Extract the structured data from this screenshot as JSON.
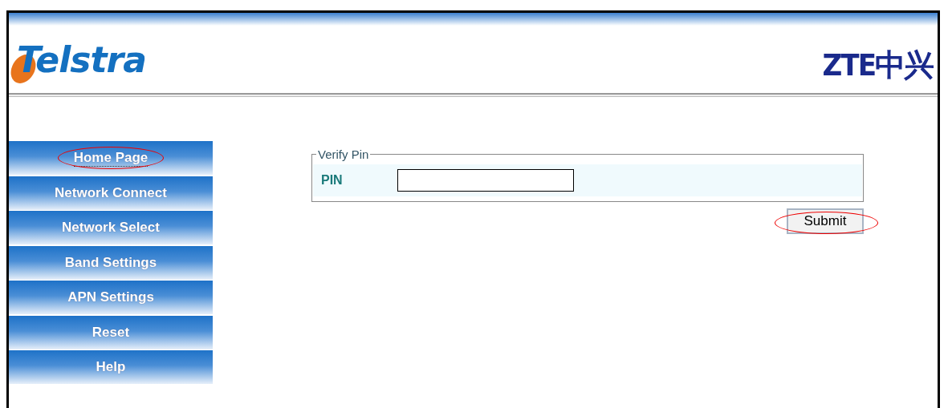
{
  "header": {
    "brand_logo": "Telstra",
    "vendor_logo": "ZTE中兴"
  },
  "sidebar": {
    "items": [
      {
        "label": "Home Page",
        "selected": true,
        "annotated": true
      },
      {
        "label": "Network Connect",
        "selected": false,
        "annotated": false
      },
      {
        "label": "Network Select",
        "selected": false,
        "annotated": false
      },
      {
        "label": "Band Settings",
        "selected": false,
        "annotated": false
      },
      {
        "label": "APN Settings",
        "selected": false,
        "annotated": false
      },
      {
        "label": "Reset",
        "selected": false,
        "annotated": false
      },
      {
        "label": "Help",
        "selected": false,
        "annotated": false
      }
    ]
  },
  "form": {
    "legend": "Verify Pin",
    "field_label": "PIN",
    "submit": {
      "label": "Submit",
      "annotated": true
    }
  }
}
